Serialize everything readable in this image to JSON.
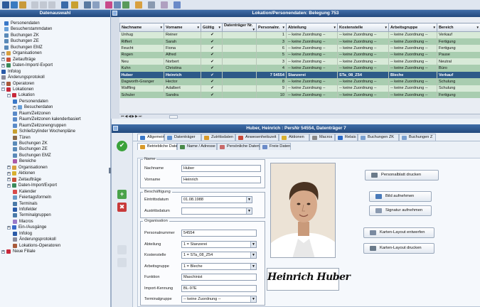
{
  "left_panel": {
    "title": "Datenauswahl",
    "tree": [
      {
        "label": "Personendaten",
        "icon": "person-icon"
      },
      {
        "label": "Besucherstammdaten",
        "icon": "visitor-icon"
      },
      {
        "label": "Buchungen ZK",
        "icon": "booking-icon"
      },
      {
        "label": "Buchungen ZE",
        "icon": "booking-icon"
      },
      {
        "label": "Buchungen EMZ",
        "icon": "booking-icon"
      },
      {
        "label": "Organisationen",
        "icon": "org-icon"
      },
      {
        "label": "Zeitaufträge",
        "icon": "time-order-icon"
      },
      {
        "label": "Daten-Import/-Export",
        "icon": "import-export-icon"
      },
      {
        "label": "Infolog",
        "icon": "info-icon"
      },
      {
        "label": "Änderungsprotokoll",
        "icon": "protocol-icon"
      },
      {
        "label": "Operatoren",
        "icon": "operator-icon"
      },
      {
        "label": "Lokationen",
        "icon": "location-icon"
      },
      {
        "label": "Lokation",
        "icon": "location-icon"
      },
      {
        "label": "Personendaten",
        "icon": "person-icon"
      },
      {
        "label": "Besucherdaten",
        "icon": "visitor-icon"
      },
      {
        "label": "Raum/Zeitzonen",
        "icon": "room-icon"
      },
      {
        "label": "Raum/Zeitzonen kalenderbasiert",
        "icon": "room-icon"
      },
      {
        "label": "Raum/Zeitzonengruppen",
        "icon": "room-icon"
      },
      {
        "label": "Schließzylinder Wochenpläne",
        "icon": "key-icon"
      },
      {
        "label": "Türen",
        "icon": "door-icon"
      },
      {
        "label": "Buchungen ZK",
        "icon": "booking-icon"
      },
      {
        "label": "Buchungen ZE",
        "icon": "booking-icon"
      },
      {
        "label": "Buchungen EMZ",
        "icon": "booking-icon"
      },
      {
        "label": "Bereiche",
        "icon": "area-icon"
      },
      {
        "label": "Organisationen",
        "icon": "org-icon"
      },
      {
        "label": "Aktionen",
        "icon": "action-icon"
      },
      {
        "label": "Zeitaufträge",
        "icon": "time-order-icon"
      },
      {
        "label": "Daten-Import/Export",
        "icon": "import-export-icon"
      },
      {
        "label": "Kalender",
        "icon": "calendar-icon"
      },
      {
        "label": "Feiertagsformeln",
        "icon": "holiday-icon"
      },
      {
        "label": "Terminals",
        "icon": "terminal-icon"
      },
      {
        "label": "Infofelder",
        "icon": "info-icon"
      },
      {
        "label": "Terminalgruppen",
        "icon": "terminal-icon"
      },
      {
        "label": "Macros",
        "icon": "macro-icon"
      },
      {
        "label": "Ein-/Ausgänge",
        "icon": "io-icon"
      },
      {
        "label": "Infolog",
        "icon": "info-icon"
      },
      {
        "label": "Änderungsprotokoll",
        "icon": "protocol-icon"
      },
      {
        "label": "Lokations-Operatoren",
        "icon": "operator-icon"
      },
      {
        "label": "Neue Filiale",
        "icon": "location-icon"
      }
    ]
  },
  "table_window": {
    "title": "Lokation/Personendaten: Belegung 753",
    "columns": [
      "Nachname",
      "Vorname",
      "Gültig",
      "Datenträger Nr.",
      "Personalnr.",
      "Abteilung",
      "Kostenstelle",
      "Arbeitsgruppe",
      "Bereich"
    ],
    "rows": [
      [
        "Unhug",
        "Reiner",
        "✔",
        "",
        "1",
        "-- keine Zuordnung --",
        "-- keine Zuordnung --",
        "-- keine Zuordnung --",
        "Verkauf"
      ],
      [
        "Riffert",
        "Sarah",
        "✔",
        "",
        "3",
        "-- keine Zuordnung --",
        "-- keine Zuordnung --",
        "-- keine Zuordnung --",
        "Fertigung"
      ],
      [
        "Feucht",
        "Fiona",
        "✔",
        "",
        "6",
        "-- keine Zuordnung --",
        "-- keine Zuordnung --",
        "-- keine Zuordnung --",
        "Fertigung"
      ],
      [
        "Rogen",
        "Alfred",
        "✔",
        "",
        "5",
        "-- keine Zuordnung --",
        "-- keine Zuordnung --",
        "-- keine Zuordnung --",
        "Pause"
      ],
      [
        "Neu",
        "Norbert",
        "✔",
        "",
        "3",
        "-- keine Zuordnung --",
        "-- keine Zuordnung --",
        "-- keine Zuordnung --",
        "Neutral"
      ],
      [
        "Kuhn",
        "Christina",
        "✔",
        "",
        "4",
        "-- keine Zuordnung --",
        "-- keine Zuordnung --",
        "-- keine Zuordnung --",
        "Büro"
      ],
      [
        "Huber",
        "Heinrich",
        "✔",
        "",
        "7 54554",
        "Stanzerei",
        "STa_08_Z54",
        "Bleche",
        "Verkauf"
      ],
      [
        "Dagworth-Granger",
        "Hector",
        "✔",
        "",
        "8",
        "-- keine Zuordnung --",
        "-- keine Zuordnung --",
        "-- keine Zuordnung --",
        "Schulung"
      ],
      [
        "Waffling",
        "Adalbert",
        "✔",
        "",
        "9",
        "-- keine Zuordnung --",
        "-- keine Zuordnung --",
        "-- keine Zuordnung --",
        "Schulung"
      ],
      [
        "Schuler",
        "Sandra",
        "✔",
        "",
        "10",
        "-- keine Zuordnung --",
        "-- keine Zuordnung --",
        "-- keine Zuordnung --",
        "Fertigung"
      ]
    ],
    "selected_row": 6
  },
  "detail_window": {
    "title": "Huber, Heinrich : PersNr 54554, Datenträger 7",
    "tabs_row1": [
      {
        "label": "Allgemein",
        "color": "#3a78c8"
      },
      {
        "label": "Datenträger",
        "color": "#5a8ed0"
      },
      {
        "label": "Zutrittsdaten",
        "color": "#d89a2a"
      },
      {
        "label": "Anwesenheitszeit",
        "color": "#c84a3a"
      },
      {
        "label": "Aktionen",
        "color": "#d8b030"
      },
      {
        "label": "Macros",
        "color": "#888888"
      },
      {
        "label": "Relais",
        "color": "#2a6ac8"
      },
      {
        "label": "Buchungen ZK",
        "color": "#7aa0d0"
      },
      {
        "label": "Buchungen Z",
        "color": "#7aa0d0"
      }
    ],
    "tabs_row2": [
      {
        "label": "Betriebliche Daten",
        "color": "#d89a2a"
      },
      {
        "label": "Name / Adresse",
        "color": "#4a8a4a"
      },
      {
        "label": "Persönliche Daten",
        "color": "#c86a6a"
      },
      {
        "label": "Freie Daten",
        "color": "#6a8ac8"
      }
    ],
    "name_group": {
      "legend": "Name",
      "fields": [
        {
          "label": "Nachname",
          "value": "Huber"
        },
        {
          "label": "Vorname",
          "value": "Heinrich"
        }
      ]
    },
    "employment_group": {
      "legend": "Beschäftigung",
      "fields": [
        {
          "label": "Eintrittsdatum",
          "value": "01.08.1988"
        },
        {
          "label": "Austrittsdatum",
          "value": ""
        }
      ]
    },
    "org_group": {
      "legend": "Organisation",
      "fields": [
        {
          "label": "Personalnummer",
          "value": "54554",
          "dropdown": false
        },
        {
          "label": "Abteilung",
          "value": "1 = Stanzerei",
          "dropdown": true
        },
        {
          "label": "Kostenstelle",
          "value": "1 = STa_08_Z54",
          "dropdown": true
        },
        {
          "label": "Arbeitsgruppe",
          "value": "1 = Bleche",
          "dropdown": true
        },
        {
          "label": "Funktion",
          "value": "Maschinist",
          "dropdown": false
        },
        {
          "label": "Import-Kennung",
          "value": "BL-97E",
          "dropdown": false
        },
        {
          "label": "Terminalgruppe",
          "value": "-- keine Zuordnung --",
          "dropdown": true
        }
      ]
    },
    "signature_text": "Heinrich Huber",
    "action_buttons": [
      {
        "label": "Personalblatt drucken",
        "icon": "print-icon",
        "color": "#6a7a8a"
      },
      {
        "label": "Bild aufnehmen",
        "icon": "camera-icon",
        "color": "#4a7ab8"
      },
      {
        "label": "Signatur aufnehmen",
        "icon": "signature-icon",
        "color": "#8a9ab0"
      },
      {
        "label": "Karten-Layout entwerfen",
        "icon": "card-design-icon",
        "color": "#7a8aa0"
      },
      {
        "label": "Karten-Layout drucken",
        "icon": "card-print-icon",
        "color": "#6a7a8a"
      }
    ]
  }
}
